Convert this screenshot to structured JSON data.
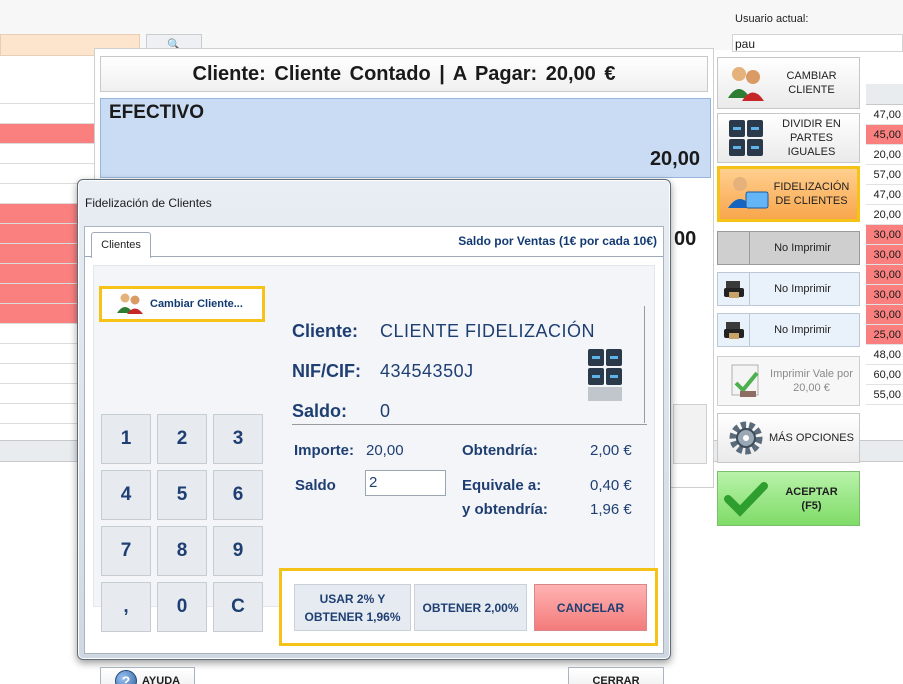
{
  "background": {
    "search_button": "🔍",
    "user_label": "Usuario actual:",
    "user_value": "pau",
    "price_rows": [
      "47,00",
      "45,00",
      "20,00",
      "57,00",
      "47,00",
      "20,00",
      "30,00",
      "30,00",
      "30,00",
      "30,00",
      "30,00",
      "25,00",
      "48,00",
      "60,00",
      "55,00"
    ],
    "price_row_highlight": [
      false,
      true,
      false,
      false,
      false,
      false,
      true,
      true,
      true,
      true,
      true,
      true,
      false,
      false,
      false
    ],
    "left_row_colors": [
      "white",
      "white",
      "red",
      "white",
      "white",
      "white",
      "red",
      "red",
      "red",
      "red",
      "red",
      "red",
      "white",
      "white",
      "white",
      "white",
      "white"
    ]
  },
  "payment": {
    "header": "Cliente: Cliente Contado | A Pagar: 20,00 €",
    "method_label": "EFECTIVO",
    "method_amount": "20,00",
    "second_amount_partial": "00"
  },
  "side_buttons": {
    "cambiar_cliente": "CAMBIAR CLIENTE",
    "dividir": "DIVIDIR EN PARTES IGUALES",
    "fidelizacion": "FIDELIZACIÓN DE CLIENTES",
    "no_imprimir_1": "No Imprimir",
    "no_imprimir_2": "No Imprimir",
    "no_imprimir_3": "No Imprimir",
    "imprimir_vale": "Imprimir Vale por 20,00 €",
    "mas_opciones": "MÁS OPCIONES",
    "aceptar": "ACEPTAR",
    "aceptar_key": "(F5)"
  },
  "dialog": {
    "title": "Fidelización de Clientes",
    "tab_label": "Clientes",
    "tab_info": "Saldo por Ventas (1€ por cada 10€)",
    "cambiar_cliente_button": "Cambiar Cliente...",
    "keypad": [
      "1",
      "2",
      "3",
      "4",
      "5",
      "6",
      "7",
      "8",
      "9",
      ",",
      "0",
      "C"
    ],
    "cliente_label": "Cliente:",
    "cliente_value": "CLIENTE FIDELIZACIÓN",
    "nif_label": "NIF/CIF:",
    "nif_value": "43454350J",
    "saldo_label": "Saldo:",
    "saldo_value": "0",
    "importe_label": "Importe:",
    "importe_value": "20,00",
    "obtendria_label": "Obtendría:",
    "obtendria_value": "2,00 €",
    "saldo_input_label": "Saldo",
    "saldo_input_value": "2",
    "equivale_label": "Equivale a:",
    "equivale_value": "0,40 €",
    "y_obtendria_label": "y obtendría:",
    "y_obtendria_value": "1,96 €",
    "usar_button_line1": "USAR 2% Y",
    "usar_button_line2": "OBTENER 1,96%",
    "obtener_button": "OBTENER 2,00%",
    "cancelar_button": "CANCELAR",
    "ayuda_button": "AYUDA",
    "cerrar_button": "CERRAR"
  },
  "colors": {
    "accent_yellow": "#f5c318",
    "text_blue": "#1f3f73",
    "cancel_red": "#f37b7b",
    "accept_green": "#7fdc68",
    "highlight_orange": "#f8a64c"
  },
  "icons": {
    "cambiar_cliente": "users-icon",
    "dividir": "calculator-grid-icon",
    "fidelizacion": "loyalty-card-icon",
    "printer": "printer-icon",
    "imprimir_vale": "stamp-icon",
    "mas_opciones": "gear-icon",
    "aceptar": "checkmark-icon",
    "ayuda": "help-icon"
  }
}
